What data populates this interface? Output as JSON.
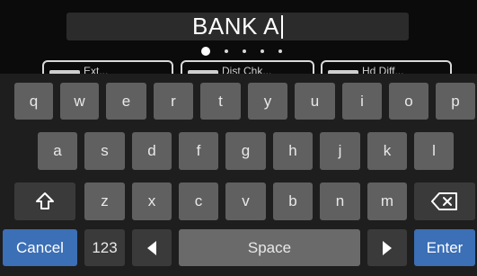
{
  "name_field": {
    "value": "BANK A"
  },
  "pager": {
    "total": 5,
    "active": 1
  },
  "presets": [
    {
      "label": "Ext..."
    },
    {
      "label": "Dist Chk..."
    },
    {
      "label": "Hd Diff..."
    }
  ],
  "keyboard": {
    "row1": [
      "q",
      "w",
      "e",
      "r",
      "t",
      "y",
      "u",
      "i",
      "o",
      "p"
    ],
    "row2": [
      "a",
      "s",
      "d",
      "f",
      "g",
      "h",
      "j",
      "k",
      "l"
    ],
    "row3": [
      "z",
      "x",
      "c",
      "v",
      "b",
      "n",
      "m"
    ],
    "shift_icon": "shift-arrow-icon",
    "backspace_icon": "backspace-icon",
    "cancel_label": "Cancel",
    "numbers_label": "123",
    "left_icon": "triangle-left-icon",
    "space_label": "Space",
    "right_icon": "triangle-right-icon",
    "enter_label": "Enter"
  },
  "colors": {
    "accent": "#3b6fb6",
    "key": "#606060",
    "background": "#1e1e1e"
  }
}
